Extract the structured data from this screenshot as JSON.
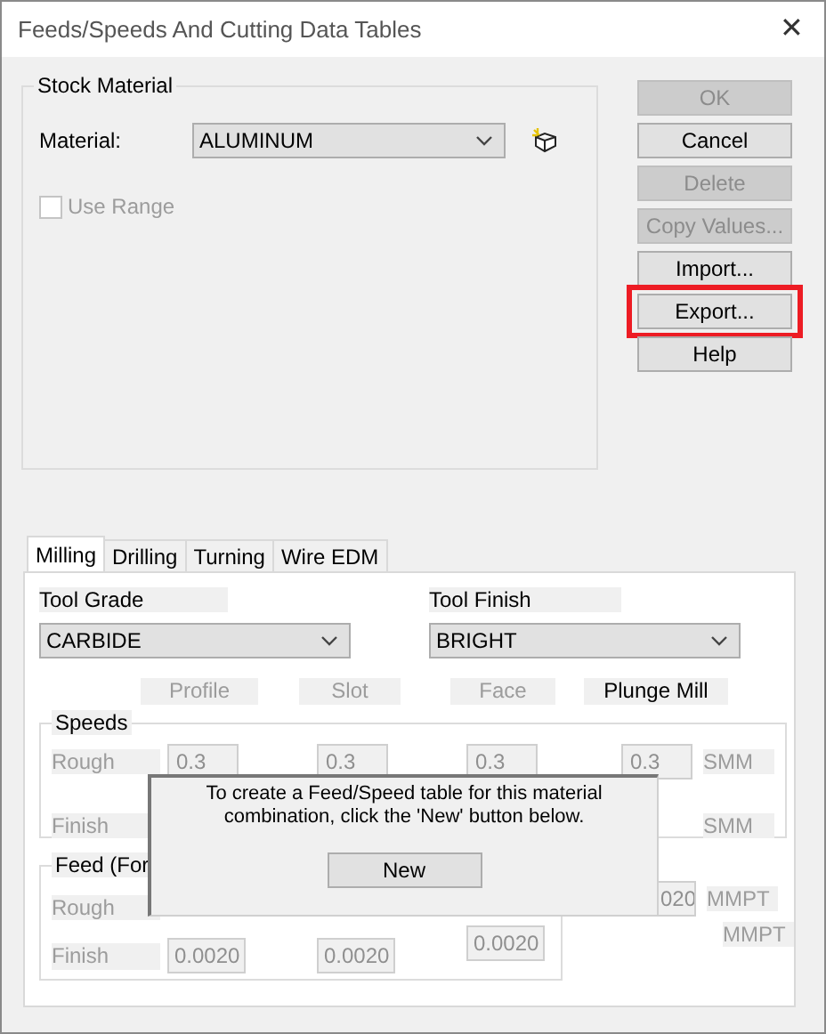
{
  "window": {
    "title": "Feeds/Speeds And Cutting Data Tables",
    "close": "✕"
  },
  "stock_material": {
    "title": "Stock Material",
    "material_label": "Material:",
    "material": "ALUMINUM",
    "use_range": {
      "label": "Use Range",
      "checked": false,
      "disabled": true
    }
  },
  "buttons": [
    {
      "label": "OK",
      "disabled": true,
      "highlighted": false
    },
    {
      "label": "Cancel",
      "disabled": false,
      "highlighted": false
    },
    {
      "label": "Delete",
      "disabled": true,
      "highlighted": false
    },
    {
      "label": "Copy Values...",
      "disabled": true,
      "highlighted": false
    },
    {
      "label": "Import...",
      "disabled": false,
      "highlighted": false
    },
    {
      "label": "Export...",
      "disabled": false,
      "highlighted": true
    },
    {
      "label": "Help",
      "disabled": false,
      "highlighted": false
    }
  ],
  "tabs": [
    {
      "label": "Milling",
      "selected": true
    },
    {
      "label": "Drilling",
      "selected": false
    },
    {
      "label": "Turning",
      "selected": false
    },
    {
      "label": "Wire EDM",
      "selected": false
    }
  ],
  "tool_grade": {
    "label": "Tool Grade",
    "value": "CARBIDE"
  },
  "tool_finish": {
    "label": "Tool Finish",
    "value": "BRIGHT"
  },
  "operations": [
    {
      "label": "Profile",
      "disabled": true
    },
    {
      "label": "Slot",
      "disabled": true
    },
    {
      "label": "Face",
      "disabled": true
    },
    {
      "label": "Plunge Mill",
      "disabled": false
    }
  ],
  "speeds": {
    "title": "Speeds",
    "rows": [
      {
        "label": "Rough",
        "values": [
          "0.3",
          "0.3",
          "0.3",
          "0.3"
        ],
        "unit": "SMM"
      },
      {
        "label": "Finish",
        "unit": "SMM"
      }
    ]
  },
  "feed": {
    "title": "Feed (For ",
    "rows": [
      {
        "label": "Rough",
        "last_value": "020",
        "unit": "MMPT"
      },
      {
        "label": "Finish",
        "values": [
          "0.0020",
          "0.0020",
          "0.0020"
        ],
        "unit": "MMPT"
      }
    ]
  },
  "notice": {
    "text": "To create a Feed/Speed table for this material combination, click the 'New' button below.",
    "button": "New"
  }
}
